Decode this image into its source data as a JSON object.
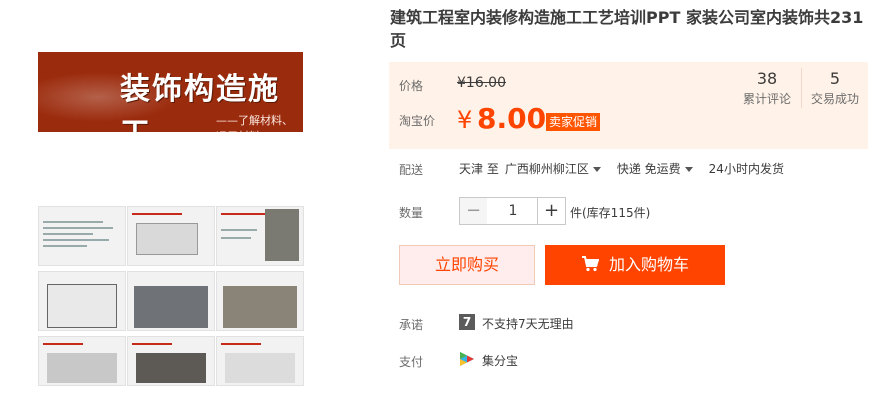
{
  "product": {
    "title": "建筑工程室内装修构造施工工艺培训PPT 家装公司室内装饰共231页",
    "banner_title": "装饰构造施工",
    "banner_subtitle": "——了解材料、运用材料"
  },
  "price": {
    "label": "价格",
    "original": "¥16.00",
    "taobao_label": "淘宝价",
    "symbol": "¥",
    "value": "8.00",
    "promo_badge": "卖家促销"
  },
  "stats": {
    "reviews_count": "38",
    "reviews_label": "累计评论",
    "sales_count": "5",
    "sales_label": "交易成功"
  },
  "delivery": {
    "label": "配送",
    "from": "天津 至",
    "to": "广西柳州柳江区",
    "method": "快递 免运费",
    "ship_time": "24小时内发货"
  },
  "quantity": {
    "label": "数量",
    "value": "1",
    "minus": "−",
    "plus": "+",
    "stock": "件(库存115件)"
  },
  "actions": {
    "buy_now": "立即购买",
    "add_to_cart": "加入购物车"
  },
  "promise": {
    "label": "承诺",
    "icon_text": "7",
    "text": "不支持7天无理由"
  },
  "payment": {
    "label": "支付",
    "text": "集分宝"
  },
  "colors": {
    "accent": "#ff4400",
    "banner": "#9b2b0d",
    "price_bg": "#fff2e8"
  }
}
